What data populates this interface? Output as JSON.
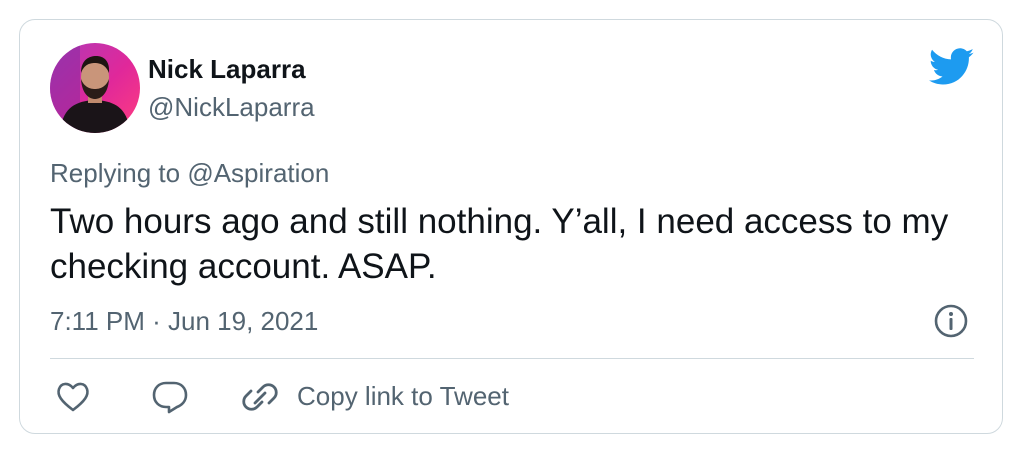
{
  "user": {
    "display_name": "Nick Laparra",
    "handle": "@NickLaparra"
  },
  "reply": {
    "prefix": "Replying to ",
    "to_handle": "@Aspiration"
  },
  "tweet": {
    "text": "Two hours ago and still nothing. Y’all, I need access to my checking account. ASAP.",
    "timestamp": "7:11 PM · Jun 19, 2021"
  },
  "actions": {
    "copy_link_label": "Copy link to Tweet"
  },
  "icons": {
    "brand": "twitter-bird-icon",
    "info": "info-icon",
    "like": "heart-icon",
    "reply": "reply-bubble-icon",
    "copy": "link-icon"
  },
  "colors": {
    "brand_blue": "#1d9bf0",
    "text_primary": "#0f1419",
    "text_secondary": "#536471",
    "border": "#cfd9de"
  }
}
